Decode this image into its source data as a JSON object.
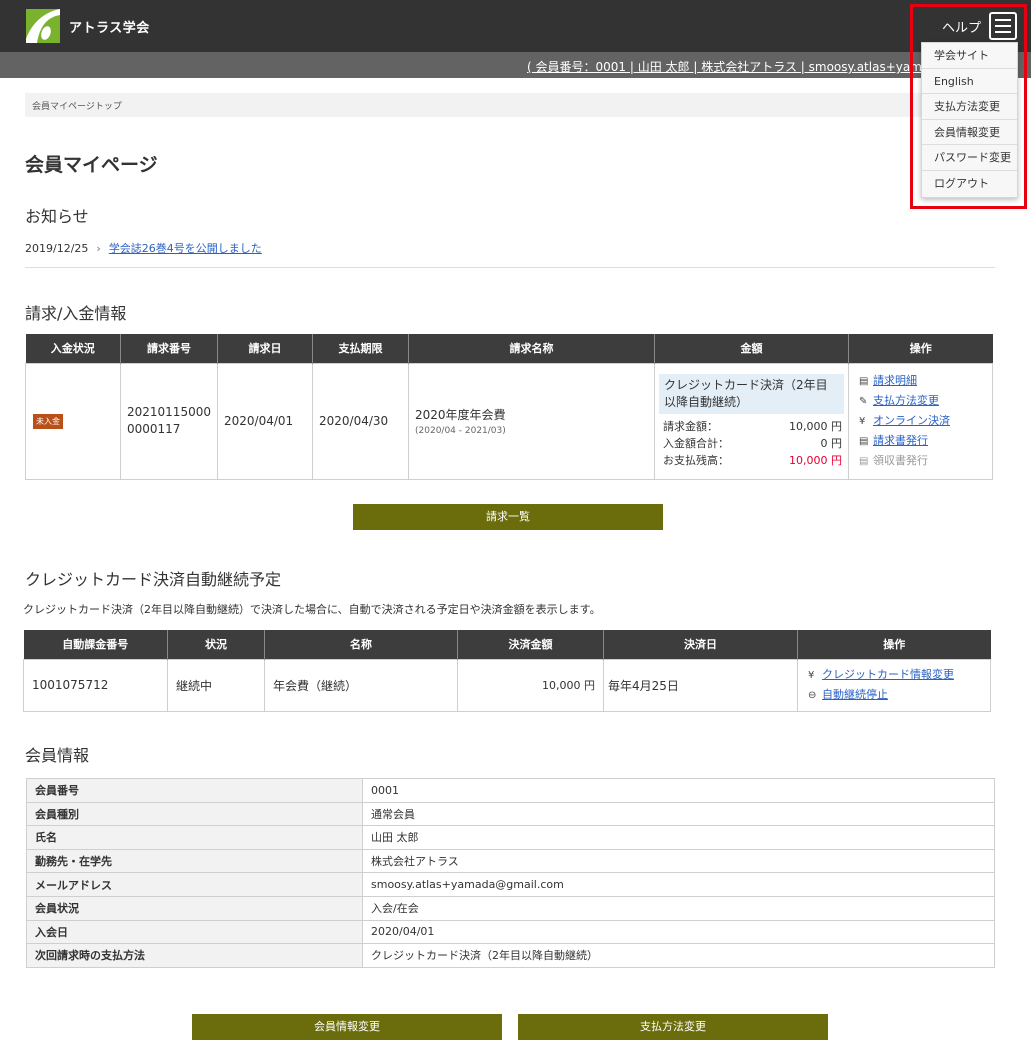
{
  "header": {
    "logo_text": "アトラス学会",
    "help_label": "ヘルプ"
  },
  "userbar": {
    "text": "( 会員番号：0001 | 山田 太郎 | 株式会社アトラス | smoosy.atlas+yamada"
  },
  "menu": {
    "items": [
      "学会サイト",
      "English",
      "支払方法変更",
      "会員情報変更",
      "パスワード変更",
      "ログアウト"
    ]
  },
  "breadcrumb": "会員マイページトップ",
  "page_title": "会員マイページ",
  "news": {
    "heading": "お知らせ",
    "date": "2019/12/25",
    "sep": "›",
    "link": "学会誌26巻4号を公開しました"
  },
  "billing": {
    "heading": "請求/入金情報",
    "columns": [
      "入金状況",
      "請求番号",
      "請求日",
      "支払期限",
      "請求名称",
      "金額",
      "操作"
    ],
    "row": {
      "status": "未入金",
      "number": "202101150000000117",
      "date": "2020/04/01",
      "due": "2020/04/30",
      "name": "2020年度年会費",
      "period": "(2020/04 - 2021/03)",
      "method": "クレジットカード決済（2年目以降自動継続）",
      "amount_label": "請求金額：",
      "amount": "10,000 円",
      "paid_label": "入金額合計：",
      "paid": "0 円",
      "balance_label": "お支払残高：",
      "balance": "10,000 円"
    },
    "ops": [
      "請求明細",
      "支払方法変更",
      "オンライン決済",
      "請求書発行",
      "領収書発行"
    ],
    "list_button": "請求一覧"
  },
  "auto": {
    "heading": "クレジットカード決済自動継続予定",
    "description": "クレジットカード決済（2年目以降自動継続）で決済した場合に、自動で決済される予定日や決済金額を表示します。",
    "columns": [
      "自動課金番号",
      "状況",
      "名称",
      "決済金額",
      "決済日",
      "操作"
    ],
    "row": {
      "number": "1001075712",
      "status": "継続中",
      "name": "年会費（継続）",
      "amount": "10,000 円",
      "date": "毎年4月25日"
    },
    "ops": [
      "クレジットカード情報変更",
      "自動継続停止"
    ]
  },
  "member": {
    "heading": "会員情報",
    "rows": [
      {
        "k": "会員番号",
        "v": "0001"
      },
      {
        "k": "会員種別",
        "v": "通常会員"
      },
      {
        "k": "氏名",
        "v": "山田 太郎"
      },
      {
        "k": "勤務先・在学先",
        "v": "株式会社アトラス"
      },
      {
        "k": "メールアドレス",
        "v": "smoosy.atlas+yamada@gmail.com"
      },
      {
        "k": "会員状況",
        "v": "入会/在会"
      },
      {
        "k": "入会日",
        "v": "2020/04/01"
      },
      {
        "k": "次回請求時の支払方法",
        "v": "クレジットカード決済（2年目以降自動継続）"
      }
    ],
    "edit_button": "会員情報変更",
    "payment_button": "支払方法変更"
  },
  "colors": {
    "header_bg": "#333333",
    "userbar_bg": "#636363",
    "olive": "#6b6d0d",
    "highlight_red": "#e60012",
    "balance_red": "#e60033",
    "logo_green": "#7bb22d"
  }
}
